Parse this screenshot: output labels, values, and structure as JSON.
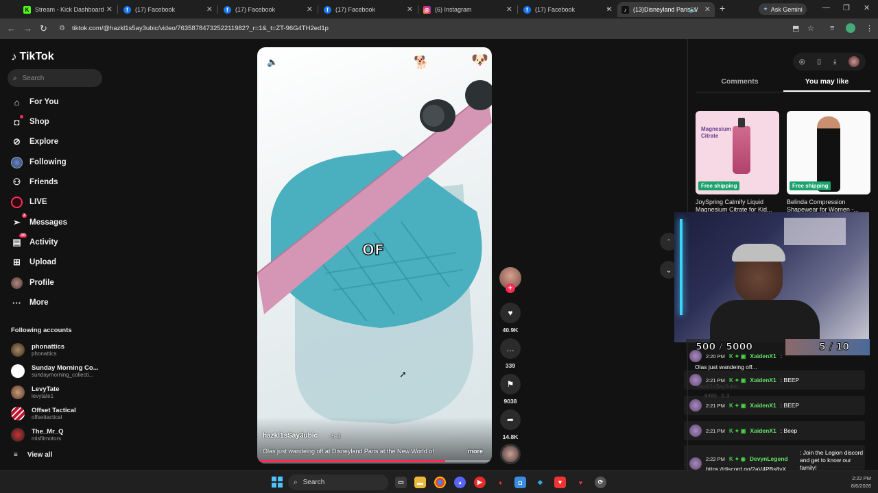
{
  "browser": {
    "tabs": [
      {
        "title": "Stream - Kick Dashboard",
        "icon": "kick-icon",
        "color": "#53fc18",
        "letter": "K"
      },
      {
        "title": "(17) Facebook",
        "icon": "facebook-icon",
        "color": "#1877f2",
        "letter": "f"
      },
      {
        "title": "(17) Facebook",
        "icon": "facebook-icon",
        "color": "#1877f2",
        "letter": "f"
      },
      {
        "title": "(17) Facebook",
        "icon": "facebook-icon",
        "color": "#1877f2",
        "letter": "f"
      },
      {
        "title": "(6) Instagram",
        "icon": "instagram-icon",
        "color": "#e1306c",
        "letter": "◎"
      },
      {
        "title": "(17) Facebook",
        "icon": "facebook-icon",
        "color": "#1877f2",
        "letter": "f"
      },
      {
        "title": "(13)Disneyland Paris W",
        "icon": "tiktok-icon",
        "color": "#111111",
        "letter": "♪"
      }
    ],
    "gemini_label": "Ask Gemini",
    "url": "tiktok.com/@hazkl1s5ay3ubic/video/7635878473252211982?_r=1&_t=ZT-96G4TH2ed1p"
  },
  "sidebar": {
    "logo": "TikTok",
    "search_placeholder": "Search",
    "nav": [
      {
        "label": "For You",
        "icon": "home-icon",
        "glyph": "⌂",
        "badge": ""
      },
      {
        "label": "Shop",
        "icon": "shop-bag-icon",
        "glyph": "🛍",
        "badge": ""
      },
      {
        "label": "Explore",
        "icon": "compass-icon",
        "glyph": "◎",
        "badge": ""
      },
      {
        "label": "Following",
        "icon": "following-avatar-icon",
        "glyph": "●",
        "badge": ""
      },
      {
        "label": "Friends",
        "icon": "friends-icon",
        "glyph": "👥",
        "badge": ""
      },
      {
        "label": "LIVE",
        "icon": "live-icon",
        "glyph": "◉",
        "badge": ""
      },
      {
        "label": "Messages",
        "icon": "messages-icon",
        "glyph": "➢",
        "badge": "3"
      },
      {
        "label": "Activity",
        "icon": "activity-icon",
        "glyph": "▤",
        "badge": "10"
      },
      {
        "label": "Upload",
        "icon": "upload-icon",
        "glyph": "⊞",
        "badge": ""
      },
      {
        "label": "Profile",
        "icon": "profile-avatar-icon",
        "glyph": "●",
        "badge": ""
      },
      {
        "label": "More",
        "icon": "more-dots-icon",
        "glyph": "···",
        "badge": ""
      }
    ],
    "following_title": "Following accounts",
    "accounts": [
      {
        "name": "phonattics",
        "handle": "phonattics",
        "color": "#5a4a3a"
      },
      {
        "name": "Sunday Morning Co...",
        "handle": "sundaymorning_collecti...",
        "color": "#ffffff"
      },
      {
        "name": "LevyTate",
        "handle": "levytate1",
        "color": "#8b6a52"
      },
      {
        "name": "Offset Tactical",
        "handle": "offsettactical",
        "color": "#c0152e"
      },
      {
        "name": "The_Mr_Q",
        "handle": "misfitmotors",
        "color": "#3a3a3a"
      }
    ],
    "view_all": "View all"
  },
  "video": {
    "caption_word": "OF",
    "author": "hazkl1sSay3ubic",
    "date": "· 5-3",
    "description": "Olas just wandeing off at Disneyland Paris at the New World of",
    "more": "more",
    "progress": 0.8
  },
  "actions": {
    "likes": "40.9K",
    "comments": "339",
    "saves": "9038",
    "shares": "14.8K"
  },
  "right_panel": {
    "tabs": [
      "Comments",
      "You may like"
    ],
    "products": [
      {
        "title": "JoySpring Calmify Liquid Magnesium Citrate for Kid...",
        "badge": "Free shipping",
        "bg": "#f4d3e4",
        "label": "Magnesium Citrate"
      },
      {
        "title": "Belinda Compression Shapewear for Women -...",
        "badge": "Free shipping",
        "bg": "#ffffff",
        "label": ""
      }
    ]
  },
  "stream_overlay": {
    "counter_left": "500 / 5000",
    "counter_right": "5 / 10",
    "chat": [
      {
        "time": "2:20 PM",
        "user": "XaidenX1",
        "msg": ":",
        "extra": "Olas just wandeing off..."
      },
      {
        "time": "2:21 PM",
        "user": "XaidenX1",
        "msg": ": BEEP"
      },
      {
        "time": "2:21 PM",
        "user": "XaidenX1",
        "msg": ": BEEP"
      },
      {
        "time": "2:21 PM",
        "user": "XaidenX1",
        "msg": ": Beep"
      },
      {
        "time": "2:22 PM",
        "user": "DevynLegend",
        "msg": ": Join the Legion discord and get to know our family!",
        "link": "https://discord.gg/2aV4PBs8yX"
      }
    ]
  },
  "taskbar": {
    "search": "Search",
    "time": "2:22 PM",
    "date": "8/6/2026"
  }
}
